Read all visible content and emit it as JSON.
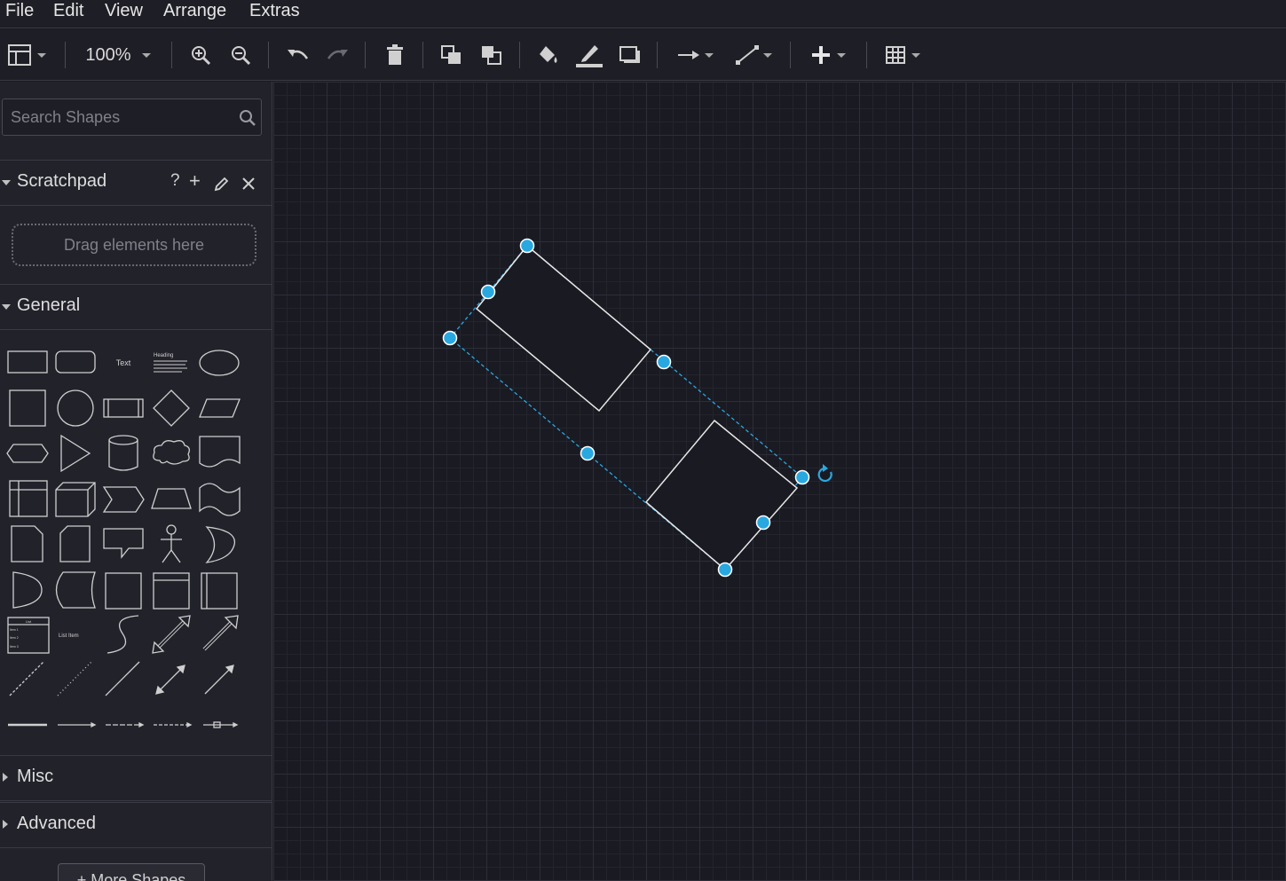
{
  "menu": {
    "file": "File",
    "edit": "Edit",
    "view": "View",
    "arrange": "Arrange",
    "extras": "Extras"
  },
  "toolbar": {
    "zoom": "100%"
  },
  "sidebar": {
    "search_placeholder": "Search Shapes",
    "scratchpad": {
      "title": "Scratchpad",
      "help": "?",
      "add": "+",
      "drop_hint": "Drag elements here"
    },
    "general": {
      "title": "General",
      "text_shape": "Text",
      "heading_shape": "Heading",
      "list_item_shape": "List Item",
      "list_shape": "List",
      "list_items": [
        "Item 1",
        "Item 2",
        "Item 3"
      ]
    },
    "misc": {
      "title": "Misc"
    },
    "advanced": {
      "title": "Advanced"
    },
    "more_shapes": "+ More Shapes"
  },
  "colors": {
    "accent": "#29a8e0",
    "background": "#1a1a23",
    "panel": "#22222b"
  },
  "icons": [
    "layout-icon",
    "zoom-in-icon",
    "zoom-out-icon",
    "undo-icon",
    "redo-icon",
    "delete-icon",
    "to-front-icon",
    "to-back-icon",
    "fill-color-icon",
    "line-color-icon",
    "shadow-icon",
    "connection-icon",
    "waypoints-icon",
    "insert-icon",
    "table-icon",
    "search-icon",
    "pencil-icon",
    "close-icon",
    "rotate-icon"
  ]
}
